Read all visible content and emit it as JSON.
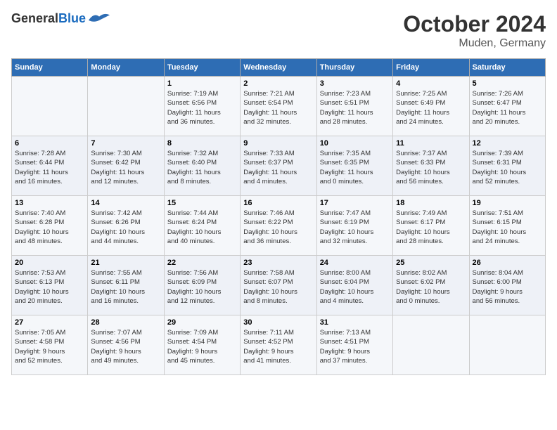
{
  "logo": {
    "general": "General",
    "blue": "Blue"
  },
  "title": "October 2024",
  "location": "Muden, Germany",
  "headers": [
    "Sunday",
    "Monday",
    "Tuesday",
    "Wednesday",
    "Thursday",
    "Friday",
    "Saturday"
  ],
  "weeks": [
    [
      {
        "day": "",
        "info": ""
      },
      {
        "day": "",
        "info": ""
      },
      {
        "day": "1",
        "info": "Sunrise: 7:19 AM\nSunset: 6:56 PM\nDaylight: 11 hours\nand 36 minutes."
      },
      {
        "day": "2",
        "info": "Sunrise: 7:21 AM\nSunset: 6:54 PM\nDaylight: 11 hours\nand 32 minutes."
      },
      {
        "day": "3",
        "info": "Sunrise: 7:23 AM\nSunset: 6:51 PM\nDaylight: 11 hours\nand 28 minutes."
      },
      {
        "day": "4",
        "info": "Sunrise: 7:25 AM\nSunset: 6:49 PM\nDaylight: 11 hours\nand 24 minutes."
      },
      {
        "day": "5",
        "info": "Sunrise: 7:26 AM\nSunset: 6:47 PM\nDaylight: 11 hours\nand 20 minutes."
      }
    ],
    [
      {
        "day": "6",
        "info": "Sunrise: 7:28 AM\nSunset: 6:44 PM\nDaylight: 11 hours\nand 16 minutes."
      },
      {
        "day": "7",
        "info": "Sunrise: 7:30 AM\nSunset: 6:42 PM\nDaylight: 11 hours\nand 12 minutes."
      },
      {
        "day": "8",
        "info": "Sunrise: 7:32 AM\nSunset: 6:40 PM\nDaylight: 11 hours\nand 8 minutes."
      },
      {
        "day": "9",
        "info": "Sunrise: 7:33 AM\nSunset: 6:37 PM\nDaylight: 11 hours\nand 4 minutes."
      },
      {
        "day": "10",
        "info": "Sunrise: 7:35 AM\nSunset: 6:35 PM\nDaylight: 11 hours\nand 0 minutes."
      },
      {
        "day": "11",
        "info": "Sunrise: 7:37 AM\nSunset: 6:33 PM\nDaylight: 10 hours\nand 56 minutes."
      },
      {
        "day": "12",
        "info": "Sunrise: 7:39 AM\nSunset: 6:31 PM\nDaylight: 10 hours\nand 52 minutes."
      }
    ],
    [
      {
        "day": "13",
        "info": "Sunrise: 7:40 AM\nSunset: 6:28 PM\nDaylight: 10 hours\nand 48 minutes."
      },
      {
        "day": "14",
        "info": "Sunrise: 7:42 AM\nSunset: 6:26 PM\nDaylight: 10 hours\nand 44 minutes."
      },
      {
        "day": "15",
        "info": "Sunrise: 7:44 AM\nSunset: 6:24 PM\nDaylight: 10 hours\nand 40 minutes."
      },
      {
        "day": "16",
        "info": "Sunrise: 7:46 AM\nSunset: 6:22 PM\nDaylight: 10 hours\nand 36 minutes."
      },
      {
        "day": "17",
        "info": "Sunrise: 7:47 AM\nSunset: 6:19 PM\nDaylight: 10 hours\nand 32 minutes."
      },
      {
        "day": "18",
        "info": "Sunrise: 7:49 AM\nSunset: 6:17 PM\nDaylight: 10 hours\nand 28 minutes."
      },
      {
        "day": "19",
        "info": "Sunrise: 7:51 AM\nSunset: 6:15 PM\nDaylight: 10 hours\nand 24 minutes."
      }
    ],
    [
      {
        "day": "20",
        "info": "Sunrise: 7:53 AM\nSunset: 6:13 PM\nDaylight: 10 hours\nand 20 minutes."
      },
      {
        "day": "21",
        "info": "Sunrise: 7:55 AM\nSunset: 6:11 PM\nDaylight: 10 hours\nand 16 minutes."
      },
      {
        "day": "22",
        "info": "Sunrise: 7:56 AM\nSunset: 6:09 PM\nDaylight: 10 hours\nand 12 minutes."
      },
      {
        "day": "23",
        "info": "Sunrise: 7:58 AM\nSunset: 6:07 PM\nDaylight: 10 hours\nand 8 minutes."
      },
      {
        "day": "24",
        "info": "Sunrise: 8:00 AM\nSunset: 6:04 PM\nDaylight: 10 hours\nand 4 minutes."
      },
      {
        "day": "25",
        "info": "Sunrise: 8:02 AM\nSunset: 6:02 PM\nDaylight: 10 hours\nand 0 minutes."
      },
      {
        "day": "26",
        "info": "Sunrise: 8:04 AM\nSunset: 6:00 PM\nDaylight: 9 hours\nand 56 minutes."
      }
    ],
    [
      {
        "day": "27",
        "info": "Sunrise: 7:05 AM\nSunset: 4:58 PM\nDaylight: 9 hours\nand 52 minutes."
      },
      {
        "day": "28",
        "info": "Sunrise: 7:07 AM\nSunset: 4:56 PM\nDaylight: 9 hours\nand 49 minutes."
      },
      {
        "day": "29",
        "info": "Sunrise: 7:09 AM\nSunset: 4:54 PM\nDaylight: 9 hours\nand 45 minutes."
      },
      {
        "day": "30",
        "info": "Sunrise: 7:11 AM\nSunset: 4:52 PM\nDaylight: 9 hours\nand 41 minutes."
      },
      {
        "day": "31",
        "info": "Sunrise: 7:13 AM\nSunset: 4:51 PM\nDaylight: 9 hours\nand 37 minutes."
      },
      {
        "day": "",
        "info": ""
      },
      {
        "day": "",
        "info": ""
      }
    ]
  ]
}
